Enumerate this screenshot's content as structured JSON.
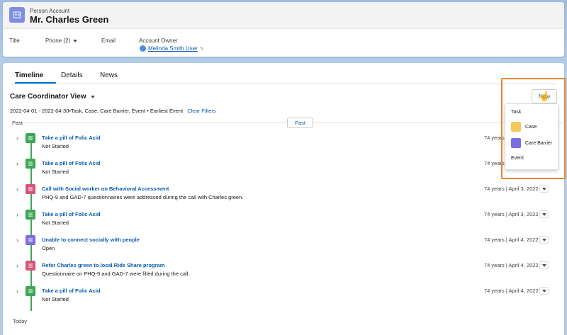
{
  "header": {
    "object_type": "Person Account",
    "name": "Mr. Charles Green",
    "fields": {
      "title_label": "Title",
      "phone_label": "Phone (2)",
      "email_label": "Email",
      "owner_label": "Account Owner",
      "owner_value": "Melinda Smith User"
    }
  },
  "tabs": [
    {
      "label": "Timeline",
      "active": true
    },
    {
      "label": "Details",
      "active": false
    },
    {
      "label": "News",
      "active": false
    }
  ],
  "view": {
    "title": "Care Coordinator View",
    "filters_text": "2022-04-01 - 2022-04-30•Task, Case, Care Barrier, Event • Earliest Event",
    "clear_filters": "Clear Filters",
    "past_label": "Past",
    "past_pill": "Past",
    "today_label": "Today"
  },
  "timeline": [
    {
      "type": "task",
      "icon": "task-icon",
      "title": "Take a pill of Folic Acid",
      "sub": "Not Started",
      "meta": "74 years |"
    },
    {
      "type": "task",
      "icon": "task-icon",
      "title": "Take a pill of Folic Acid",
      "sub": "Not Started",
      "meta": "74 years |"
    },
    {
      "type": "event",
      "icon": "event-icon",
      "title": "Call with Social worker on Behavioral Accessment",
      "sub": "PHQ-9 and GAD-7 questionnaires were addressed during the call with Charles green.",
      "meta": "74 years | April 3, 2022"
    },
    {
      "type": "task",
      "icon": "task-icon",
      "title": "Take a pill of Folic Acid",
      "sub": "Not Started",
      "meta": "74 years | April 3, 2022"
    },
    {
      "type": "barrier",
      "icon": "care-barrier-icon",
      "title": "Unable to connect socially with people",
      "sub": "Open",
      "meta": "74 years | April 4, 2022"
    },
    {
      "type": "event",
      "icon": "event-icon",
      "title": "Refer Charles green to local Ride Share program",
      "sub": "Questionnaire on PHQ-9 and GAD-7 were filled during the call.",
      "meta": "74 years | April 4, 2022"
    },
    {
      "type": "task",
      "icon": "task-icon",
      "title": "Take a pill of Folic Acid",
      "sub": "Not Started",
      "meta": "74 years | April 4, 2022"
    }
  ],
  "new_menu": {
    "button_label": "New",
    "items": [
      {
        "label": "Task",
        "icon": ""
      },
      {
        "label": "Case",
        "icon": "case-icon",
        "color": "#f4c95d"
      },
      {
        "label": "Care Barrier",
        "icon": "care-barrier-icon",
        "color": "#7a6ee0"
      },
      {
        "label": "Event",
        "icon": ""
      }
    ]
  },
  "colors": {
    "task": "#3ba755",
    "event": "#d4537a",
    "barrier": "#7a6ee0",
    "link": "#0b5cab",
    "highlight": "#e08a2e"
  }
}
